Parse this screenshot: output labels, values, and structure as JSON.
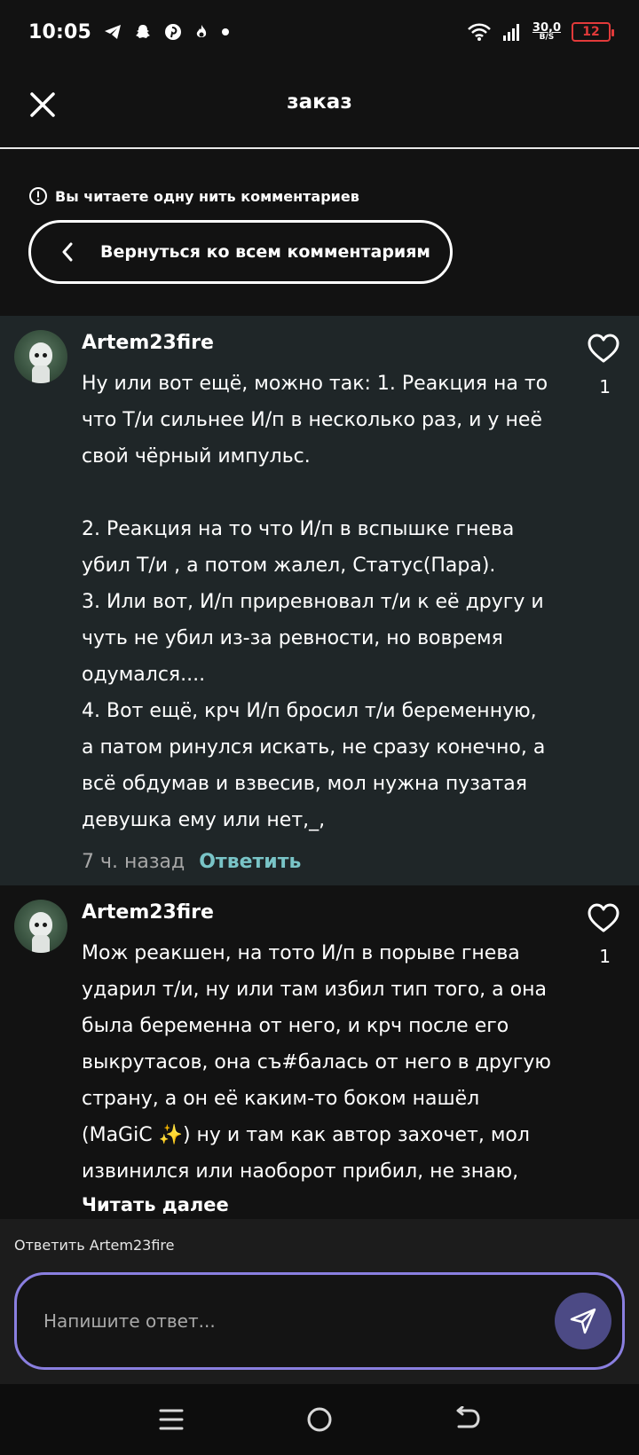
{
  "status_bar": {
    "time": "10:05",
    "icons": [
      "telegram-icon",
      "snapchat-icon",
      "pinterest-icon",
      "fire-icon",
      "dot-icon"
    ],
    "net_speed_value": "30,0",
    "net_speed_unit": "B/S",
    "battery": "12",
    "battery_color": "#e23a3a"
  },
  "header": {
    "title": "заказ",
    "close_icon": "close-icon"
  },
  "thread_notice": {
    "text": "Вы читаете одну нить комментариев",
    "back_button_label": "Вернуться ко всем комментариям"
  },
  "comments": [
    {
      "author": "Artem23fire",
      "text": "Ну или вот ещё, можно так: 1. Реакция на то что Т/и сильнее И/п в несколько раз, и у неё свой чёрный импульс.\n\n2. Реакция на то что И/п в вспышке гнева убил Т/и , а потом жалел, Статус(Пара).\n3. Или вот, И/п приревновал т/и к её другу и чуть не убил из-за ревности, но вовремя одумался....\n4. Вот ещё, крч И/п бросил т/и беременную, а патом ринулся искать, не сразу конечно, а всё обдумав и взвесив, мол нужна пузатая девушка ему или нет,_,",
      "likes": "1",
      "time": "7 ч. назад",
      "reply_label": "Ответить"
    },
    {
      "author": "Artem23fire",
      "text": "Мож реакшен, на тото И/п в порыве гнева ударил т/и, ну или там избил тип того, а она была беременна от него, и крч после его выкрутасов, она съ#балась от него в другую страну, а он её каким-то боком нашёл (MaGiC ✨) ну и там как автор захочет, мол извинился или наоборот прибил, не знаю,",
      "likes": "1",
      "read_more": "Читать далее"
    }
  ],
  "composer": {
    "replying_to": "Ответить Artem23fire",
    "placeholder": "Напишите ответ...",
    "accent_color": "#8a7fe0"
  },
  "nav": [
    "menu-icon",
    "home-icon",
    "back-icon"
  ]
}
